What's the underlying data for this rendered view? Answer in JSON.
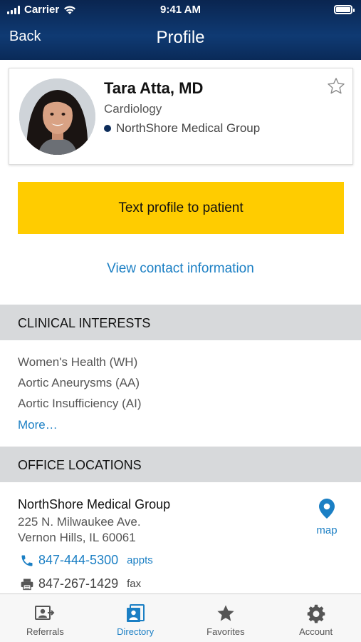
{
  "status_bar": {
    "carrier": "Carrier",
    "time": "9:41 AM"
  },
  "nav": {
    "back_label": "Back",
    "title": "Profile"
  },
  "profile": {
    "name": "Tara Atta, MD",
    "specialty": "Cardiology",
    "group": "NorthShore Medical Group",
    "favorite_icon": "star-outline-icon"
  },
  "actions": {
    "text_profile_label": "Text profile to patient",
    "view_contact_label": "View contact information"
  },
  "clinical_interests": {
    "header": "CLINICAL INTERESTS",
    "items": [
      "Women's Health (WH)",
      "Aortic Aneurysms (AA)",
      "Aortic Insufficiency (AI)"
    ],
    "more_label": "More…"
  },
  "office_locations": {
    "header": "OFFICE LOCATIONS",
    "name": "NorthShore Medical Group",
    "address_line1": "225 N. Milwaukee Ave.",
    "address_line2": "Vernon Hills, IL 60061",
    "map_label": "map",
    "phone": "847-444-5300",
    "phone_tag": "appts",
    "fax": "847-267-1429",
    "fax_tag": "fax"
  },
  "tabbar": {
    "items": [
      {
        "label": "Referrals",
        "icon": "referrals-icon"
      },
      {
        "label": "Directory",
        "icon": "directory-icon"
      },
      {
        "label": "Favorites",
        "icon": "star-icon"
      },
      {
        "label": "Account",
        "icon": "gear-icon"
      }
    ],
    "active": "Directory"
  },
  "colors": {
    "header_bg": "#0f3a73",
    "accent": "#1b7fc4",
    "button": "#ffcc00",
    "section_bg": "#d7d9db"
  }
}
